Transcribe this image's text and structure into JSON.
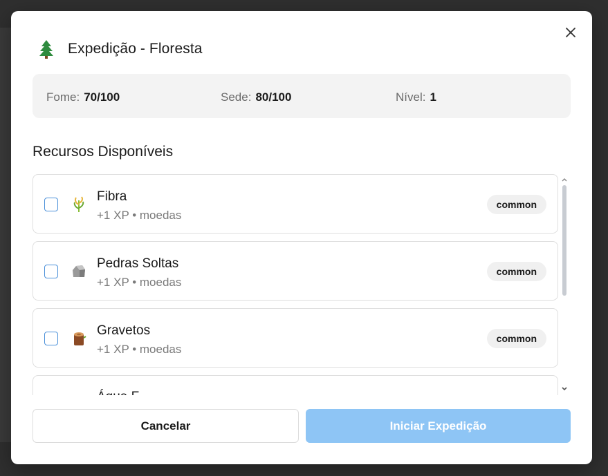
{
  "modal": {
    "title": "Expedição - Floresta",
    "header_icon": "pine-tree-icon",
    "close_icon": "close-icon"
  },
  "stats": {
    "fome_label": "Fome:",
    "fome_value": "70/100",
    "sede_label": "Sede:",
    "sede_value": "80/100",
    "nivel_label": "Nível:",
    "nivel_value": "1"
  },
  "resources": {
    "title": "Recursos Disponíveis",
    "items": [
      {
        "name": "Fibra",
        "meta": "+1 XP • moedas",
        "rarity": "common",
        "icon": "fiber-plant-icon",
        "checked": false
      },
      {
        "name": "Pedras Soltas",
        "meta": "+1 XP • moedas",
        "rarity": "common",
        "icon": "rock-icon",
        "checked": false
      },
      {
        "name": "Gravetos",
        "meta": "+1 XP • moedas",
        "rarity": "common",
        "icon": "wood-log-icon",
        "checked": false
      },
      {
        "name": "Água F",
        "meta": "",
        "rarity": "",
        "icon": "",
        "checked": false
      }
    ]
  },
  "footer": {
    "cancel_label": "Cancelar",
    "start_label": "Iniciar Expedição"
  },
  "colors": {
    "accent_disabled": "#8ec5f5",
    "checkbox_border": "#4a90d9"
  }
}
